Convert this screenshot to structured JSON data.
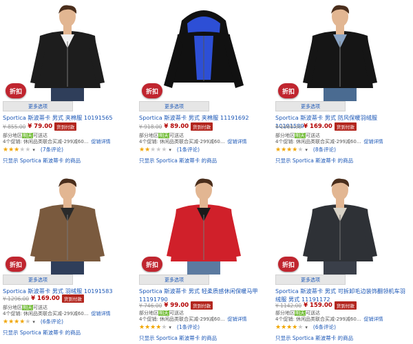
{
  "common": {
    "badge": "折扣",
    "more_options": "更多选项",
    "cod": "货到付款",
    "availability_prefix": "部分地区",
    "tomorrow": "明天",
    "availability_suffix": "可送达",
    "promo_link": "促销详情",
    "only_show": "只显示 Sportica 斯波蒂卡 的商品"
  },
  "products": [
    {
      "title": "Sportica 斯波蒂卡 男式 夹棉服 10191565",
      "old_price": "¥ 855.00",
      "price": "¥ 79.00",
      "promo": "4个促销: 休闲品类联合买减-299减60...",
      "stars": 3.5,
      "reviews": "(7条评论)",
      "shirt_color": "#1d1d1d",
      "accent": "#f2f2f2",
      "bg": "#ffffff",
      "skin": "#e2b692",
      "pants": "#2f3e5a"
    },
    {
      "title": "Sportica 斯波蒂卡 男式 夹棉服 11191692",
      "old_price": "¥ 918.00",
      "price": "¥ 89.00",
      "promo": "4个促销: 休闲品类联合买减-299减60...",
      "stars": 2,
      "reviews": "(1条评论)",
      "shirt_color": "#111111",
      "accent": "#2d4fd6",
      "bg": "#ffffff",
      "skin": "#e2b692",
      "pants": "#2f3e5a"
    },
    {
      "title": "Sportica 斯波蒂卡 男式 防风保暖羽绒服 10191589",
      "old_price": "¥ 1368.00",
      "price": "¥ 169.00",
      "promo": "4个促销: 休闲品类联合买减-299减60...",
      "stars": 4.5,
      "reviews": "(8条评论)",
      "shirt_color": "#151515",
      "accent": "#8aa4c4",
      "bg": "#ffffff",
      "skin": "#e2b692",
      "pants": "#4a6b91"
    },
    {
      "title": "Sportica 斯波蒂卡 男式 羽绒服 10191583",
      "old_price": "¥ 1296.00",
      "price": "¥ 169.00",
      "promo": "4个促销: 休闲品类联合买减-299减60...",
      "stars": 4,
      "reviews": "(6条评论)",
      "shirt_color": "#7a5a3e",
      "accent": "#2a2a2a",
      "bg": "#ffffff",
      "skin": "#e2b692",
      "pants": "#2f3e5a"
    },
    {
      "title": "Sportica 斯波蒂卡 男式 轻柔质感休闲保暖马甲 11191790",
      "old_price": "¥ 746.00",
      "price": "¥ 99.00",
      "promo": "4个促销: 休闲品类联合买减-299减60...",
      "stars": 4,
      "reviews": "(1条评论)",
      "shirt_color": "#d0202a",
      "accent": "#1a1a1a",
      "bg": "#ffffff",
      "skin": "#e2b692",
      "pants": "#5b7aa0"
    },
    {
      "title": "Sportica 斯波蒂卡 男式 可拆卸毛边装饰翻领机车羽绒服 男式 11191172",
      "old_price": "¥ 1142.00",
      "price": "¥ 159.00",
      "promo": "4个促销: 休闲品类联合买减-299减60...",
      "stars": 4,
      "reviews": "(6条评论)",
      "shirt_color": "#2e3136",
      "accent": "#d8d2c6",
      "bg": "#ffffff",
      "skin": "#e2b692",
      "pants": "#3a3f49"
    }
  ]
}
